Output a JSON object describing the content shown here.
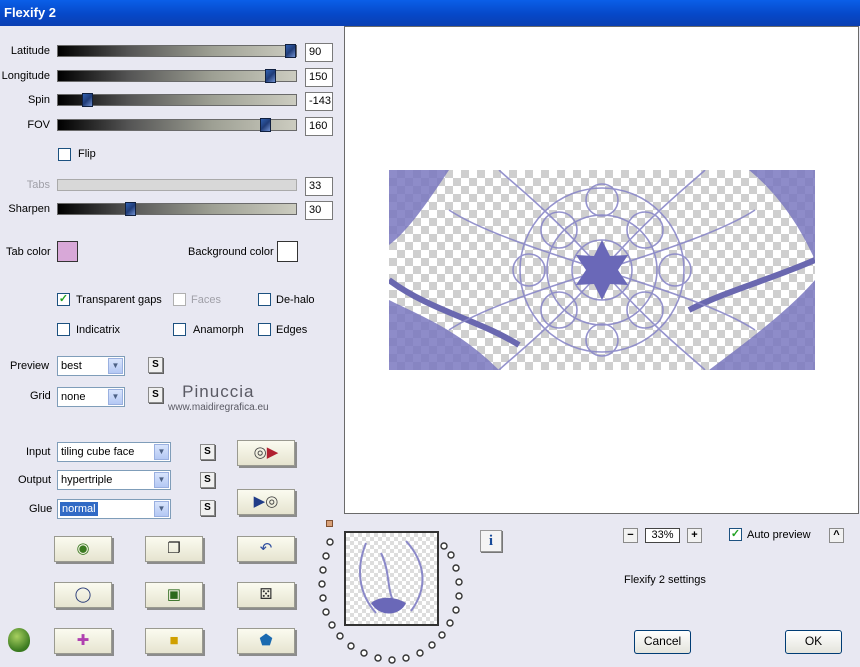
{
  "window": {
    "title": "Flexify 2"
  },
  "sliders": [
    {
      "label": "Latitude",
      "value": "90",
      "position": 0.97,
      "enabled": true
    },
    {
      "label": "Longitude",
      "value": "150",
      "position": 0.89,
      "enabled": true
    },
    {
      "label": "Spin",
      "value": "-143",
      "position": 0.11,
      "enabled": true
    },
    {
      "label": "FOV",
      "value": "160",
      "position": 0.86,
      "enabled": true
    },
    {
      "label": "Tabs",
      "value": "33",
      "enabled": false
    },
    {
      "label": "Sharpen",
      "value": "30",
      "position": 0.3,
      "enabled": true
    }
  ],
  "flip": {
    "label": "Flip",
    "checked": false
  },
  "colors": {
    "tab_color_label": "Tab color",
    "tab_color": "#d8a8d8",
    "background_color_label": "Background color",
    "background_color": "#ffffff"
  },
  "options": {
    "transparent_gaps": {
      "label": "Transparent gaps",
      "checked": true
    },
    "faces": {
      "label": "Faces",
      "checked": false,
      "enabled": false
    },
    "de_halo": {
      "label": "De-halo",
      "checked": false
    },
    "indicatrix": {
      "label": "Indicatrix",
      "checked": false
    },
    "anamorph": {
      "label": "Anamorph",
      "checked": false
    },
    "edges": {
      "label": "Edges",
      "checked": false
    }
  },
  "selects": {
    "preview": {
      "label": "Preview",
      "value": "best"
    },
    "grid": {
      "label": "Grid",
      "value": "none"
    },
    "input": {
      "label": "Input",
      "value": "tiling cube face"
    },
    "output": {
      "label": "Output",
      "value": "hypertriple"
    },
    "glue": {
      "label": "Glue",
      "value": "normal"
    }
  },
  "s_button_label": "S",
  "watermark": {
    "line1": "Pinuccia",
    "line2": "www.maidiregrafica.eu"
  },
  "zoom": {
    "minus": "−",
    "value": "33%",
    "plus": "+"
  },
  "auto_preview": {
    "label": "Auto preview",
    "checked": true,
    "toggle": "^"
  },
  "settings_text": "Flexify 2 settings",
  "info_label": "i",
  "buttons": {
    "cancel": "Cancel",
    "ok": "OK"
  },
  "accent": {
    "purple": "#7a78c0",
    "titlebar": "#0a5fe8"
  }
}
